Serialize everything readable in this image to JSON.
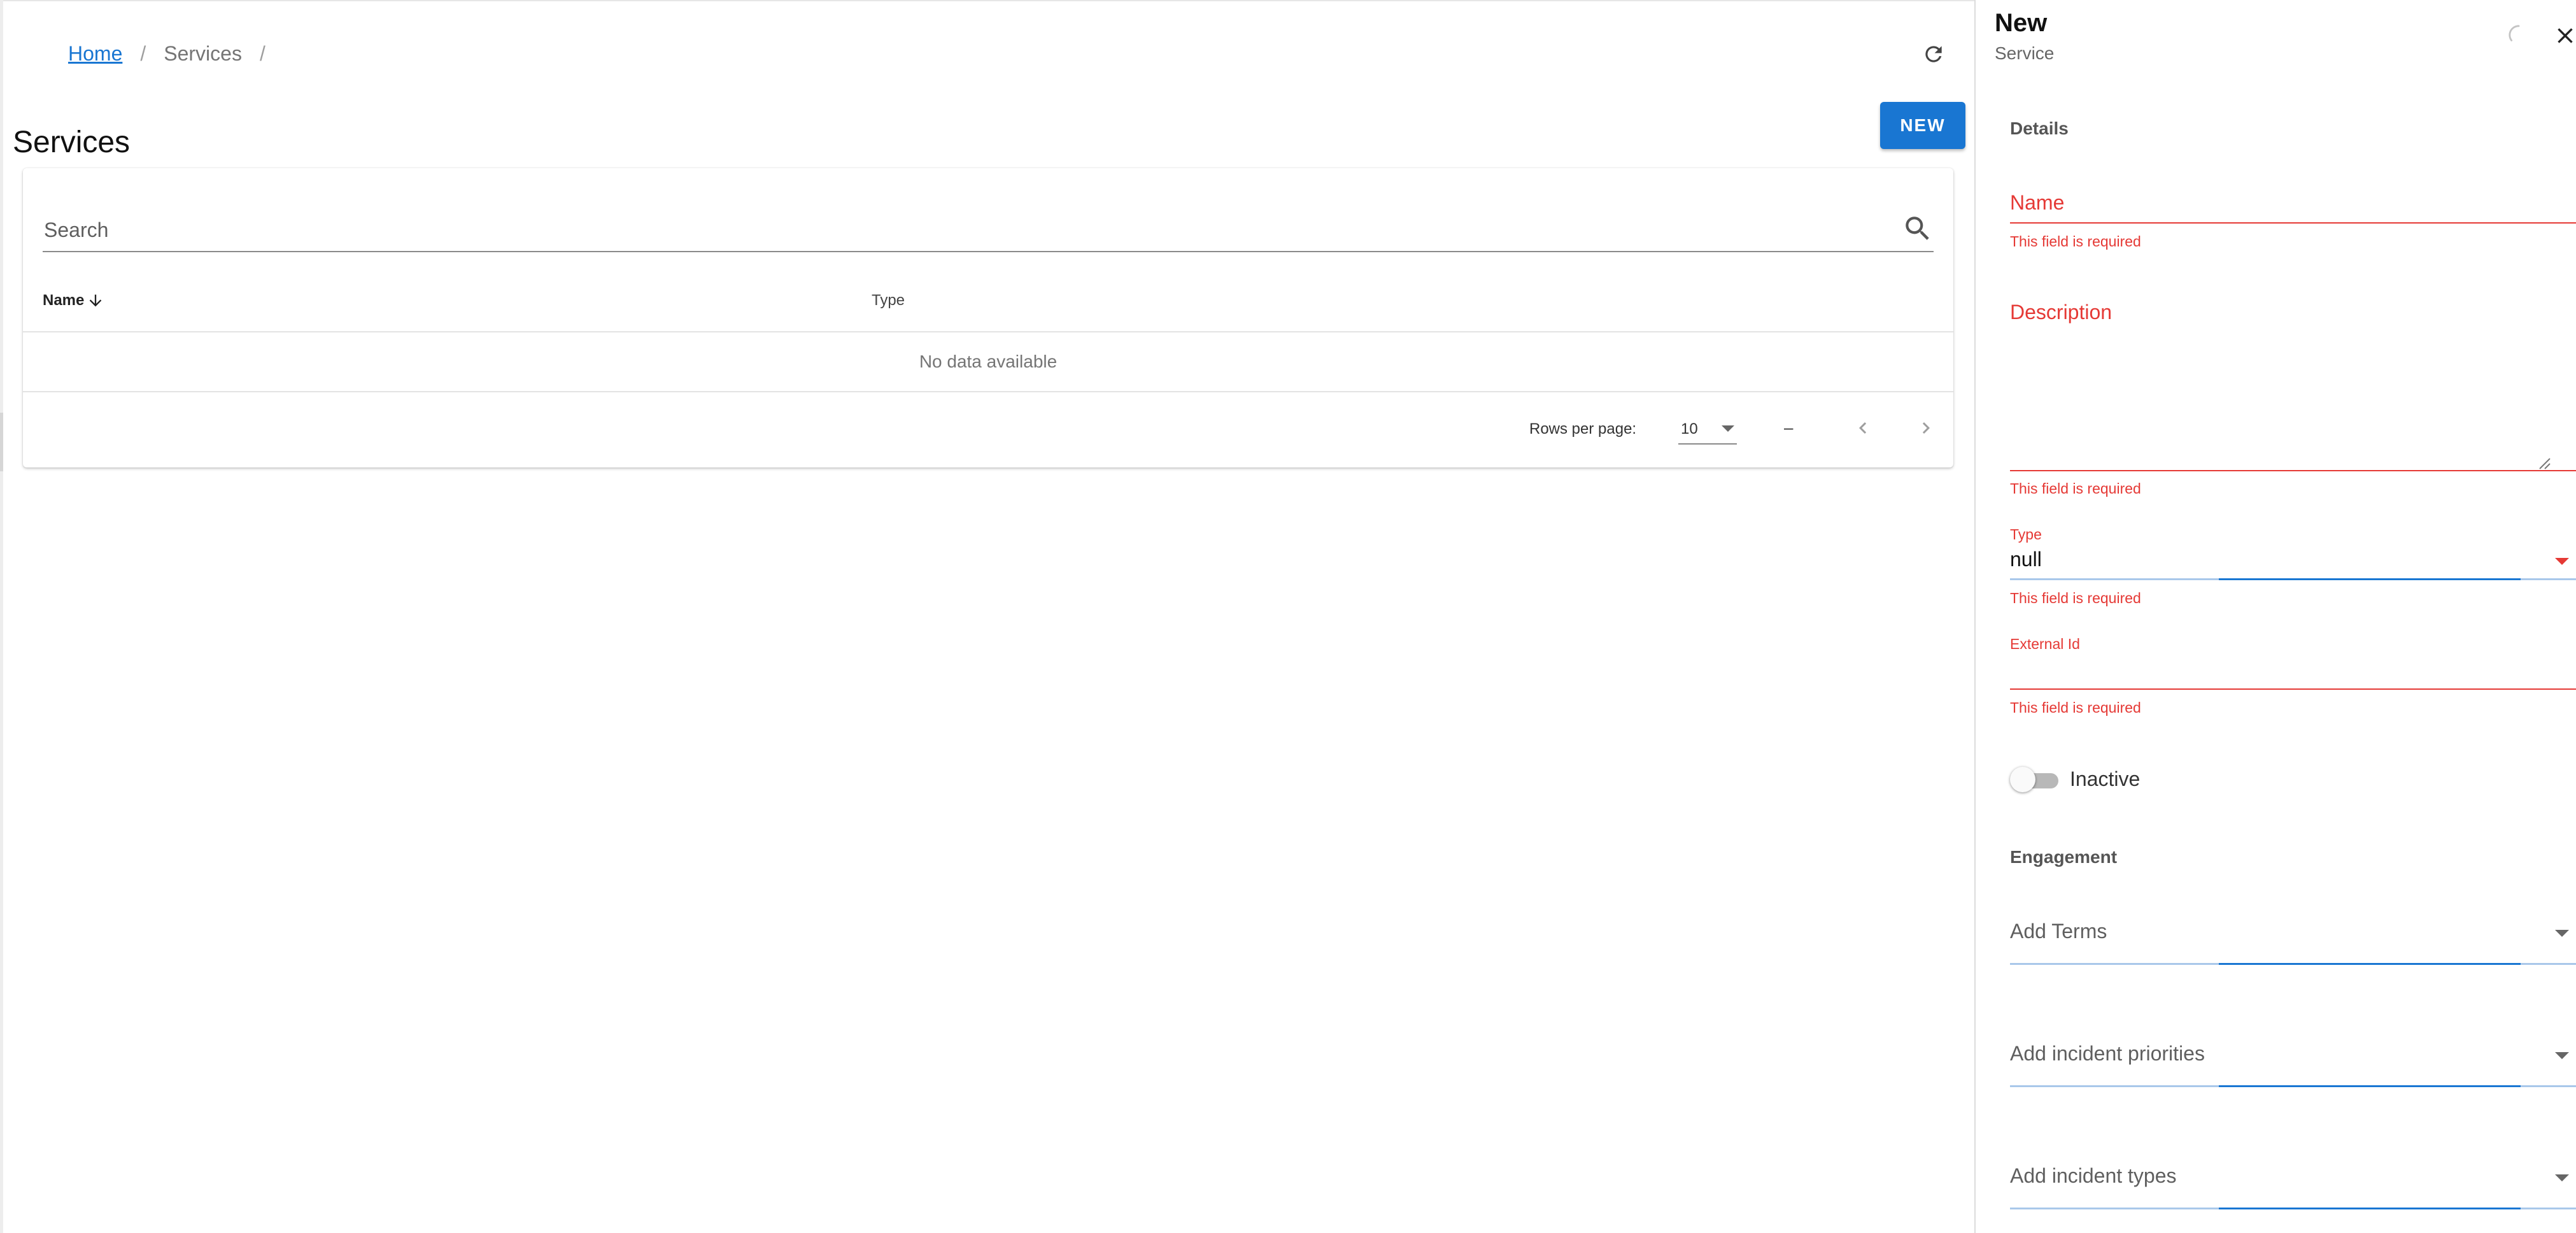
{
  "breadcrumb": {
    "home": "Home",
    "current": "Services",
    "separator": "/"
  },
  "page": {
    "title": "Services",
    "new_button": "NEW"
  },
  "search": {
    "placeholder": "Search"
  },
  "table": {
    "columns": [
      {
        "label": "Name",
        "sort": "desc"
      },
      {
        "label": "Type"
      }
    ],
    "empty_text": "No data available"
  },
  "pagination": {
    "rows_label": "Rows per page:",
    "rows_value": "10",
    "range": "–"
  },
  "drawer": {
    "title": "New",
    "subtitle": "Service",
    "details_label": "Details",
    "fields": {
      "name": {
        "label": "Name",
        "error": "This field is required"
      },
      "description": {
        "label": "Description",
        "error": "This field is required"
      },
      "type": {
        "label": "Type",
        "value": "null",
        "error": "This field is required"
      },
      "external_id": {
        "label": "External Id",
        "error": "This field is required"
      }
    },
    "toggle": {
      "label": "Inactive",
      "checked": false
    },
    "engagement_label": "Engagement",
    "selects": {
      "terms": "Add Terms",
      "priorities": "Add incident priorities",
      "types": "Add incident types"
    }
  },
  "colors": {
    "primary": "#1976d2",
    "error": "#e53935"
  },
  "icons": [
    "refresh-icon",
    "search-icon",
    "arrow-down-icon",
    "chevron-left-icon",
    "chevron-right-icon",
    "close-icon",
    "spinner-icon"
  ]
}
